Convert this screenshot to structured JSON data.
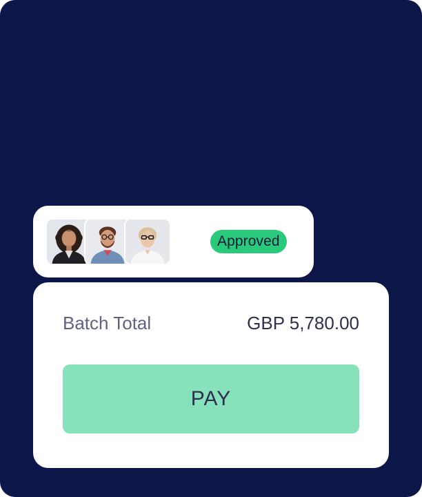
{
  "approvers": [
    {
      "name_icon": "woman-curly-hair-avatar",
      "bg": "#e3e5ec"
    },
    {
      "name_icon": "man-beard-glasses-avatar",
      "bg": "#e8eaf0"
    },
    {
      "name_icon": "woman-blonde-glasses-avatar",
      "bg": "#e6e7ed"
    }
  ],
  "status_badge": {
    "label": "Approved",
    "color": "#2bc97b"
  },
  "batch": {
    "label": "Batch Total",
    "amount": "GBP 5,780.00"
  },
  "pay_button": {
    "label": "PAY",
    "color": "#87e2bc"
  },
  "colors": {
    "background": "#0d1649",
    "card": "#ffffff"
  }
}
